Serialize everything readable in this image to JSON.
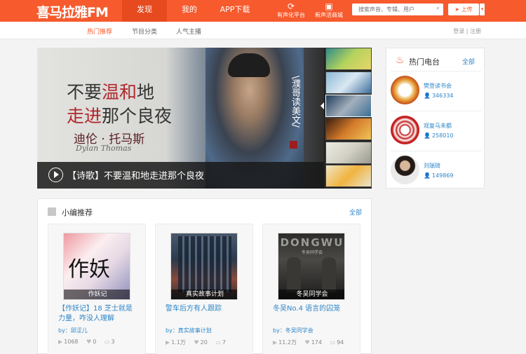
{
  "header": {
    "logo": "喜马拉雅FM",
    "nav": [
      "发现",
      "我的",
      "APP下载"
    ],
    "icons": [
      {
        "label": "有声化平台",
        "icon": "audiobook-platform-icon"
      },
      {
        "label": "新声活商城",
        "icon": "shopping-bag-icon"
      }
    ],
    "search_placeholder": "搜索声音、专辑、用户",
    "upload_label": "上传"
  },
  "subnav": {
    "items": [
      "热门推荐",
      "节目分类",
      "人气主播"
    ],
    "login": "登录",
    "register": "注册"
  },
  "banner": {
    "line1_a": "不要",
    "line1_b": "温和",
    "line1_c": "地",
    "line2_a": "走进",
    "line2_b": "那个良夜",
    "author_cn": "迪伦 · 托马斯",
    "author_en": "Dylan Thomas",
    "vertical": "\\濮哥读美文/",
    "caption": "【诗歌】不要温和地走进那个良夜"
  },
  "editor_picks": {
    "title": "小编推荐",
    "all_label": "全部",
    "items": [
      {
        "cover_label": "作妖记",
        "cover_text": "作妖",
        "title": "【作妖记】18 芝士就是力量，咋没人理解",
        "by": "by：邱涩儿",
        "plays": "1068",
        "likes": "0",
        "comments": "3"
      },
      {
        "cover_label": "真实故事计划",
        "title": "警车后方有人跟踪",
        "by": "by：真实故事计划",
        "plays": "1.1万",
        "likes": "20",
        "comments": "7"
      },
      {
        "cover_label": "冬吴同学会",
        "cover_text": "DONGWU",
        "cover_subtext": "冬吴同学会",
        "title": "冬吴No.4 语言的囚笼",
        "by": "by：冬吴同学会",
        "plays": "11.2万",
        "likes": "174",
        "comments": "94"
      }
    ]
  },
  "hot_radio": {
    "title": "热门电台",
    "all_label": "全部",
    "stations": [
      {
        "name": "樊登读书会",
        "count": "346334"
      },
      {
        "name": "观复马未都",
        "count": "258010"
      },
      {
        "name": "刘瑞琦",
        "count": "149869"
      }
    ]
  },
  "colors": {
    "brand": "#f75a2d",
    "link": "#2e86c9"
  }
}
